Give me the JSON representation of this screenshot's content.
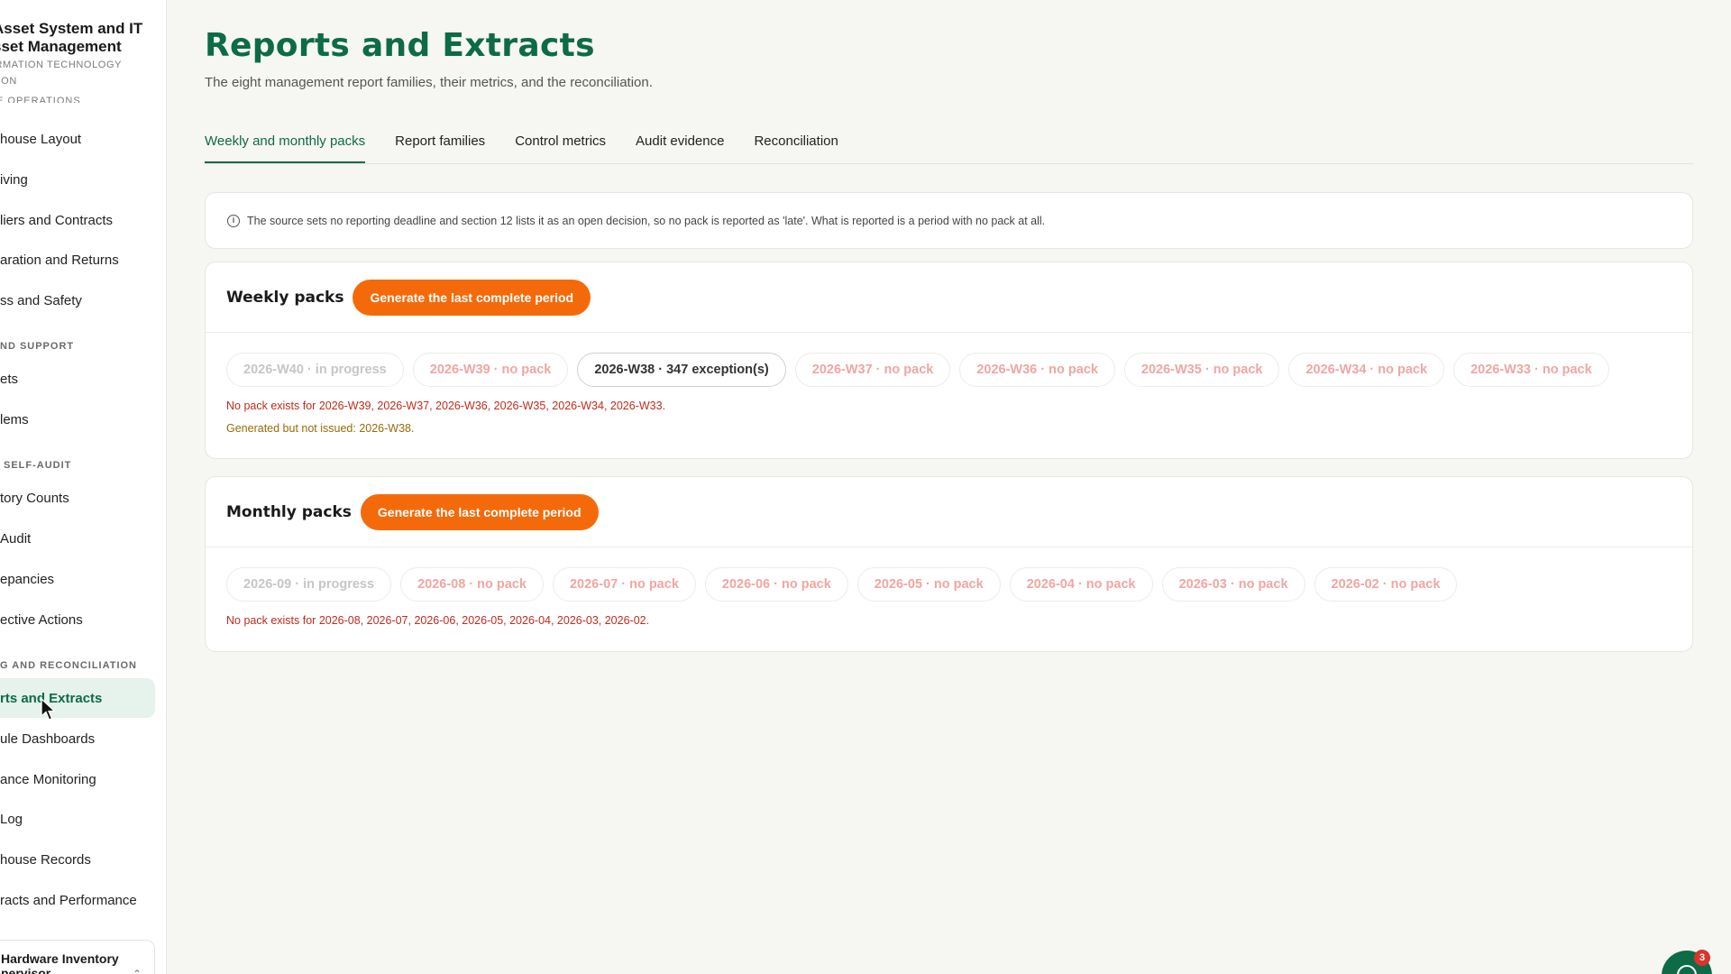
{
  "app": {
    "title": "Asset System and IT\nsset Management",
    "title_line1": "Asset System and IT",
    "title_line2": "sset Management",
    "subtitle": "FORMATION TECHNOLOGY\nVISION"
  },
  "sidebar": {
    "cut_section": "E OPERATIONS",
    "items": [
      {
        "label": "house Layout"
      },
      {
        "label": "iving"
      },
      {
        "label": "liers and Contracts"
      },
      {
        "label": "aration and Returns"
      },
      {
        "label": "ss and Safety"
      }
    ],
    "section_support": "ND SUPPORT",
    "support_items": [
      {
        "label": "ets"
      },
      {
        "label": "lems"
      }
    ],
    "section_audit": "SELF-AUDIT",
    "audit_items": [
      {
        "label": "tory Counts"
      },
      {
        "label": "Audit"
      },
      {
        "label": "epancies"
      },
      {
        "label": "ective Actions"
      }
    ],
    "section_reporting": "G AND RECONCILIATION",
    "reporting_items": [
      {
        "label": "rts and Extracts",
        "active": true
      },
      {
        "label": "ule Dashboards"
      },
      {
        "label": "ance Monitoring"
      },
      {
        "label": "Log"
      },
      {
        "label": "house Records"
      },
      {
        "label": "racts and Performance"
      }
    ],
    "user": {
      "name": "Hardware Inventory\npervisor"
    }
  },
  "page": {
    "title": "Reports and Extracts",
    "subtitle": "The eight management report families, their metrics, and the reconciliation."
  },
  "tabs": [
    {
      "label": "Weekly and monthly packs",
      "active": true
    },
    {
      "label": "Report families"
    },
    {
      "label": "Control metrics"
    },
    {
      "label": "Audit evidence"
    },
    {
      "label": "Reconciliation"
    }
  ],
  "notice": {
    "icon": "info-icon",
    "text": "The source sets no reporting deadline and section 12 lists it as an open decision, so no pack is reported as 'late'. What is reported is a period with no pack at all."
  },
  "weekly": {
    "title": "Weekly packs",
    "button": "Generate the last complete period",
    "chips": [
      {
        "label": "2026-W40 · in progress",
        "state": "progress"
      },
      {
        "label": "2026-W39 · no pack",
        "state": "nopack"
      },
      {
        "label": "2026-W38 · 347 exception(s)",
        "state": "exception"
      },
      {
        "label": "2026-W37 · no pack",
        "state": "nopack"
      },
      {
        "label": "2026-W36 · no pack",
        "state": "nopack"
      },
      {
        "label": "2026-W35 · no pack",
        "state": "nopack"
      },
      {
        "label": "2026-W34 · no pack",
        "state": "nopack"
      },
      {
        "label": "2026-W33 · no pack",
        "state": "nopack"
      }
    ],
    "missing_note": "No pack exists for 2026-W39, 2026-W37, 2026-W36, 2026-W35, 2026-W34, 2026-W33.",
    "issued_note": "Generated but not issued: 2026-W38."
  },
  "monthly": {
    "title": "Monthly packs",
    "button": "Generate the last complete period",
    "chips": [
      {
        "label": "2026-09 · in progress",
        "state": "progress"
      },
      {
        "label": "2026-08 · no pack",
        "state": "nopack"
      },
      {
        "label": "2026-07 · no pack",
        "state": "nopack"
      },
      {
        "label": "2026-06 · no pack",
        "state": "nopack"
      },
      {
        "label": "2026-05 · no pack",
        "state": "nopack"
      },
      {
        "label": "2026-04 · no pack",
        "state": "nopack"
      },
      {
        "label": "2026-03 · no pack",
        "state": "nopack"
      },
      {
        "label": "2026-02 · no pack",
        "state": "nopack"
      }
    ],
    "missing_note": "No pack exists for 2026-08, 2026-07, 2026-06, 2026-05, 2026-04, 2026-03, 2026-02."
  },
  "chat": {
    "badge": "3",
    "icon": "chat-icon"
  },
  "colors": {
    "brand": "#0d6b47",
    "accent": "#f46a0a",
    "danger": "#c22a1d",
    "warning": "#9a6a06"
  }
}
